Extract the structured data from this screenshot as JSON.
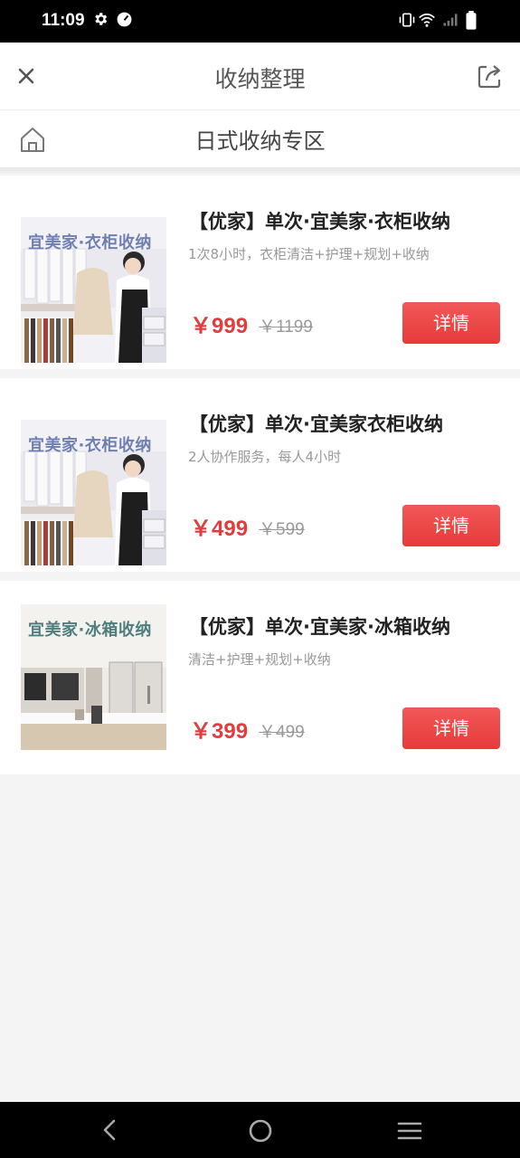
{
  "status": {
    "time": "11:09"
  },
  "header": {
    "title": "收纳整理"
  },
  "section": {
    "title": "日式收纳专区"
  },
  "products": [
    {
      "thumb_text": "宜美家·衣柜收纳",
      "title": "【优家】单次·宜美家·衣柜收纳",
      "desc": "1次8小时，衣柜清洁+护理+规划+收纳",
      "price": "￥999",
      "old_price": "￥1199",
      "button": "详情"
    },
    {
      "thumb_text": "宜美家·衣柜收纳",
      "title": "【优家】单次·宜美家衣柜收纳",
      "desc": "2人协作服务，每人4小时",
      "price": "￥499",
      "old_price": "￥599",
      "button": "详情"
    },
    {
      "thumb_text": "宜美家·冰箱收纳",
      "title": "【优家】单次·宜美家·冰箱收纳",
      "desc": "清洁+护理+规划+收纳",
      "price": "￥399",
      "old_price": "￥499",
      "button": "详情"
    }
  ],
  "icons": {
    "close": "close-icon",
    "share": "share-icon",
    "home": "home-icon",
    "back": "back-icon",
    "home_nav": "home-circle-icon",
    "menu": "menu-icon"
  },
  "colors": {
    "accent": "#e63b3b",
    "background": "#f4f4f4"
  }
}
